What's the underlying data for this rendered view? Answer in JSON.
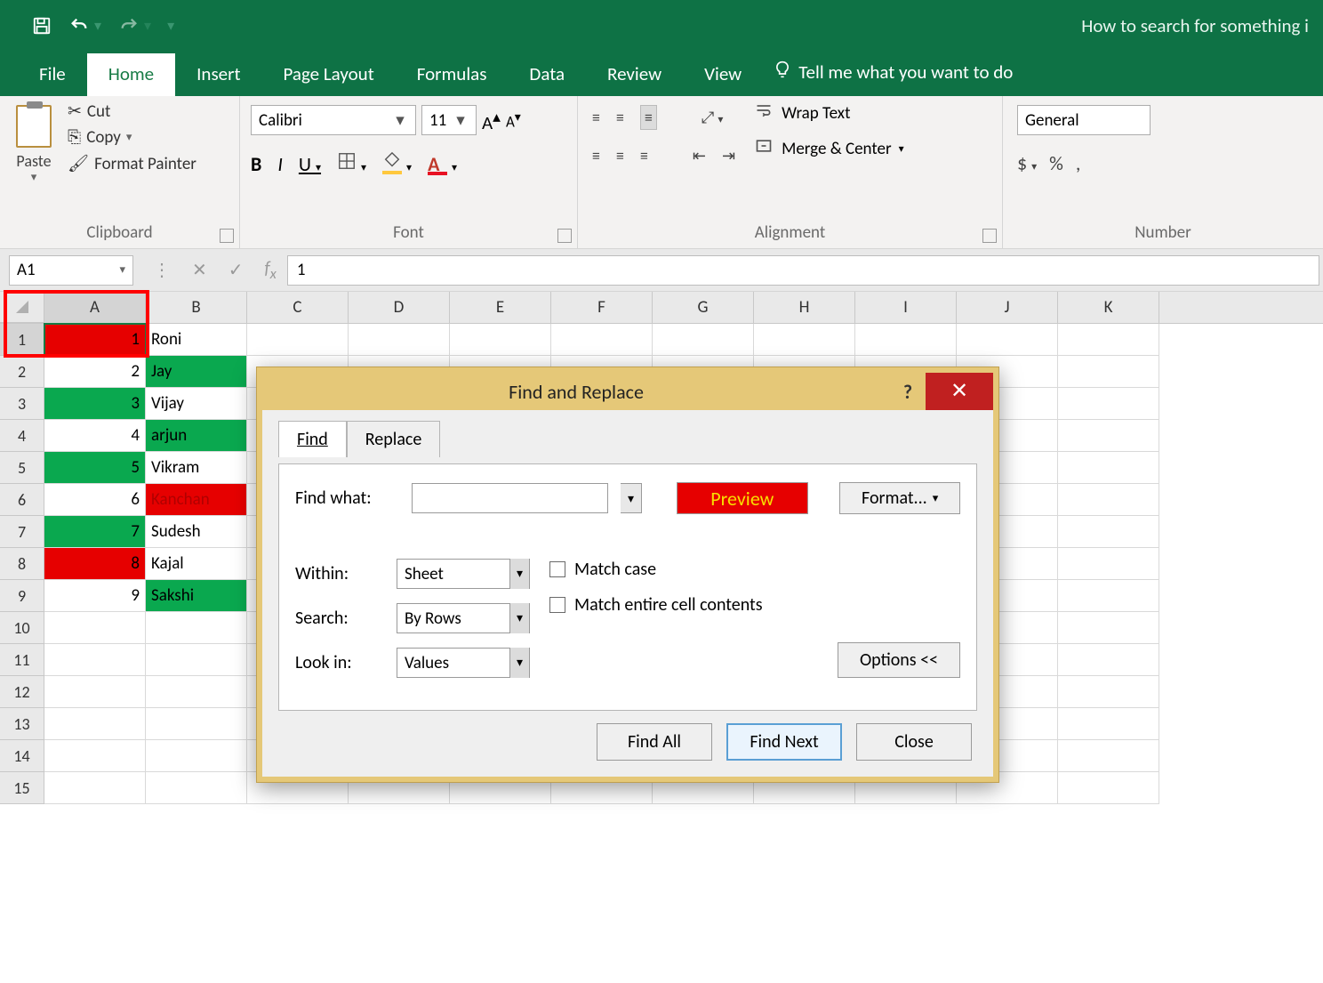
{
  "title": "How to search for something i",
  "qat": {
    "save": "save",
    "undo": "undo",
    "redo": "redo"
  },
  "tabs": [
    "File",
    "Home",
    "Insert",
    "Page Layout",
    "Formulas",
    "Data",
    "Review",
    "View"
  ],
  "active_tab": "Home",
  "tellme": "Tell me what you want to do",
  "ribbon": {
    "clipboard": {
      "label": "Clipboard",
      "paste": "Paste",
      "cut": "Cut",
      "copy": "Copy",
      "format_painter": "Format Painter"
    },
    "font": {
      "label": "Font",
      "name": "Calibri",
      "size": "11",
      "bold": "B",
      "italic": "I",
      "underline": "U"
    },
    "alignment": {
      "label": "Alignment",
      "wrap": "Wrap Text",
      "merge": "Merge & Center"
    },
    "number": {
      "label": "Number",
      "format": "General",
      "currency": "$",
      "percent": "%",
      "comma": ","
    }
  },
  "namebox": "A1",
  "formula_value": "1",
  "columns": [
    "A",
    "B",
    "C",
    "D",
    "E",
    "F",
    "G",
    "H",
    "I",
    "J",
    "K"
  ],
  "rows": [
    {
      "n": 1,
      "a": "1",
      "b": "Roni",
      "abg": "red",
      "bbg": ""
    },
    {
      "n": 2,
      "a": "2",
      "b": "Jay",
      "abg": "",
      "bbg": "green"
    },
    {
      "n": 3,
      "a": "3",
      "b": "Vijay",
      "abg": "green",
      "bbg": ""
    },
    {
      "n": 4,
      "a": "4",
      "b": "arjun",
      "abg": "",
      "bbg": "green"
    },
    {
      "n": 5,
      "a": "5",
      "b": "Vikram",
      "abg": "green",
      "bbg": ""
    },
    {
      "n": 6,
      "a": "6",
      "b": "Kanchan",
      "abg": "",
      "bbg": "redred"
    },
    {
      "n": 7,
      "a": "7",
      "b": "Sudesh",
      "abg": "green",
      "bbg": ""
    },
    {
      "n": 8,
      "a": "8",
      "b": "Kajal",
      "abg": "red",
      "bbg": ""
    },
    {
      "n": 9,
      "a": "9",
      "b": "Sakshi",
      "abg": "",
      "bbg": "green"
    },
    {
      "n": 10,
      "a": "",
      "b": "",
      "abg": "",
      "bbg": ""
    },
    {
      "n": 11,
      "a": "",
      "b": "",
      "abg": "",
      "bbg": ""
    },
    {
      "n": 12,
      "a": "",
      "b": "",
      "abg": "",
      "bbg": ""
    },
    {
      "n": 13,
      "a": "",
      "b": "",
      "abg": "",
      "bbg": ""
    },
    {
      "n": 14,
      "a": "",
      "b": "",
      "abg": "",
      "bbg": ""
    },
    {
      "n": 15,
      "a": "",
      "b": "",
      "abg": "",
      "bbg": ""
    }
  ],
  "dialog": {
    "title": "Find and Replace",
    "tabs": {
      "find": "Find",
      "replace": "Replace"
    },
    "find_what": "Find what:",
    "find_value": "",
    "preview": "Preview",
    "format": "Format...",
    "within_label": "Within:",
    "within_value": "Sheet",
    "search_label": "Search:",
    "search_value": "By Rows",
    "lookin_label": "Look in:",
    "lookin_value": "Values",
    "match_case": "Match case",
    "match_entire": "Match entire cell contents",
    "options": "Options <<",
    "find_all": "Find All",
    "find_next": "Find Next",
    "close": "Close"
  }
}
